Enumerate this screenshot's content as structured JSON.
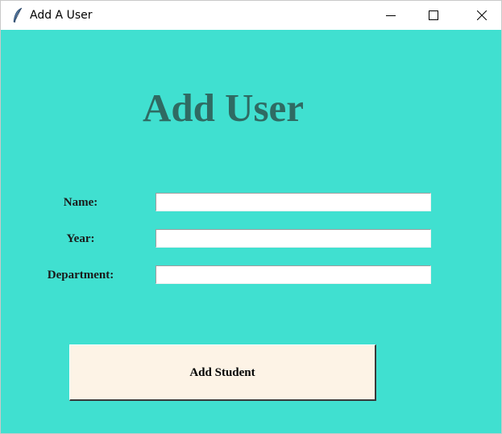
{
  "window": {
    "title": "Add A User",
    "icon": "feather-icon",
    "controls": {
      "minimize_icon": "minimize-icon",
      "maximize_icon": "maximize-icon",
      "close_icon": "close-icon"
    }
  },
  "form": {
    "heading": "Add User",
    "fields": [
      {
        "label": "Name:",
        "value": ""
      },
      {
        "label": "Year:",
        "value": ""
      },
      {
        "label": "Department:",
        "value": ""
      }
    ],
    "submit_label": "Add Student"
  },
  "colors": {
    "background": "#40e0d0",
    "heading": "#2f6b63",
    "button_background": "#fdf3e6"
  }
}
